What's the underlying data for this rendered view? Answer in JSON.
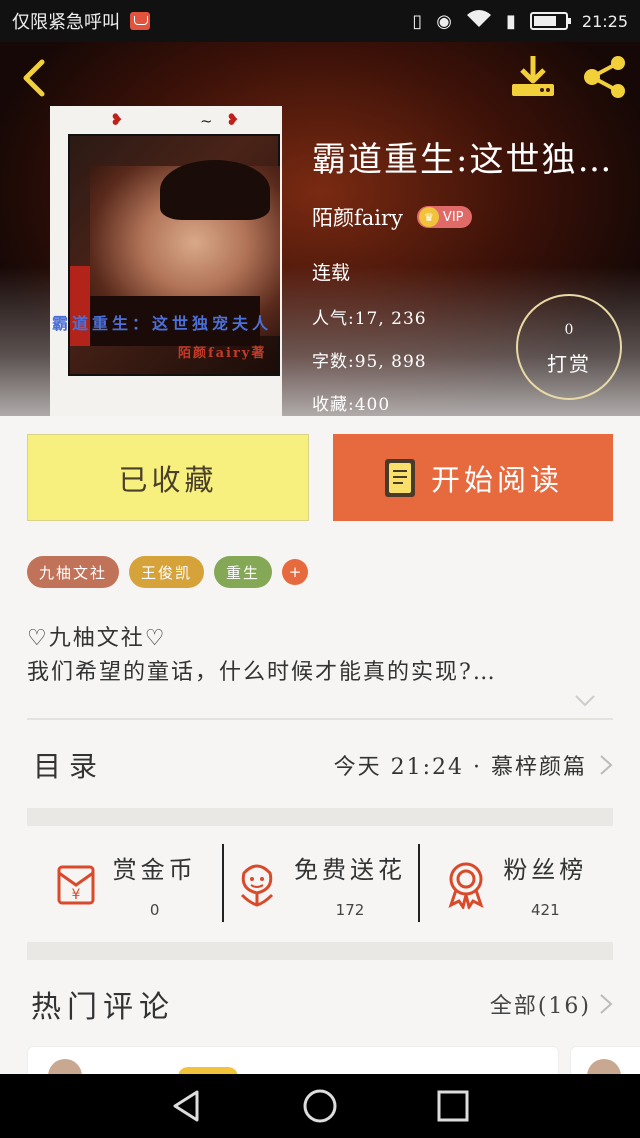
{
  "status_bar": {
    "carrier_text": "仅限紧急呼叫",
    "time": "21:25",
    "icons": [
      "mail-icon",
      "vibrate-icon",
      "eye-icon",
      "wifi-icon",
      "sim-icon",
      "battery-icon"
    ]
  },
  "header": {
    "back_icon": "back-arrow-icon",
    "download_icon": "download-icon",
    "share_icon": "share-icon",
    "accent_color": "#f2d03a"
  },
  "book": {
    "cover_title": "霸道重生：这世独宠夫人",
    "cover_author": "陌颜fairy著",
    "title": "霸道重生:这世独宠夫人",
    "author": "陌颜fairy",
    "vip_label": "VIP",
    "serial_status": "连载",
    "popularity": "人气:17, 236",
    "word_count": "字数:95, 898",
    "favorites": "收藏:400"
  },
  "reward": {
    "count": "0",
    "label": "打赏"
  },
  "buttons": {
    "collected": "已收藏",
    "start_reading": "开始阅读"
  },
  "tags": [
    "九柚文社",
    "王俊凯",
    "重生"
  ],
  "tag_add": "+",
  "intro": {
    "line1": "♡九柚文社♡",
    "line2": "我们希望的童话，什么时候才能真的实现?…"
  },
  "catalog": {
    "title": "目录",
    "update": "今天 21:24 · 慕梓颜篇"
  },
  "actions": [
    {
      "name": "coin",
      "icon": "coin-envelope-icon",
      "label": "赏金币",
      "value": "0"
    },
    {
      "name": "flower",
      "icon": "flower-icon",
      "label": "免费送花",
      "value": "172"
    },
    {
      "name": "fans",
      "icon": "medal-icon",
      "label": "粉丝榜",
      "value": "421"
    }
  ],
  "comments": {
    "title": "热门评论",
    "all_label": "全部(16)"
  },
  "colors": {
    "orange": "#e76a3e",
    "yellow": "#f8f07e",
    "icon_red": "#d94a2a"
  }
}
